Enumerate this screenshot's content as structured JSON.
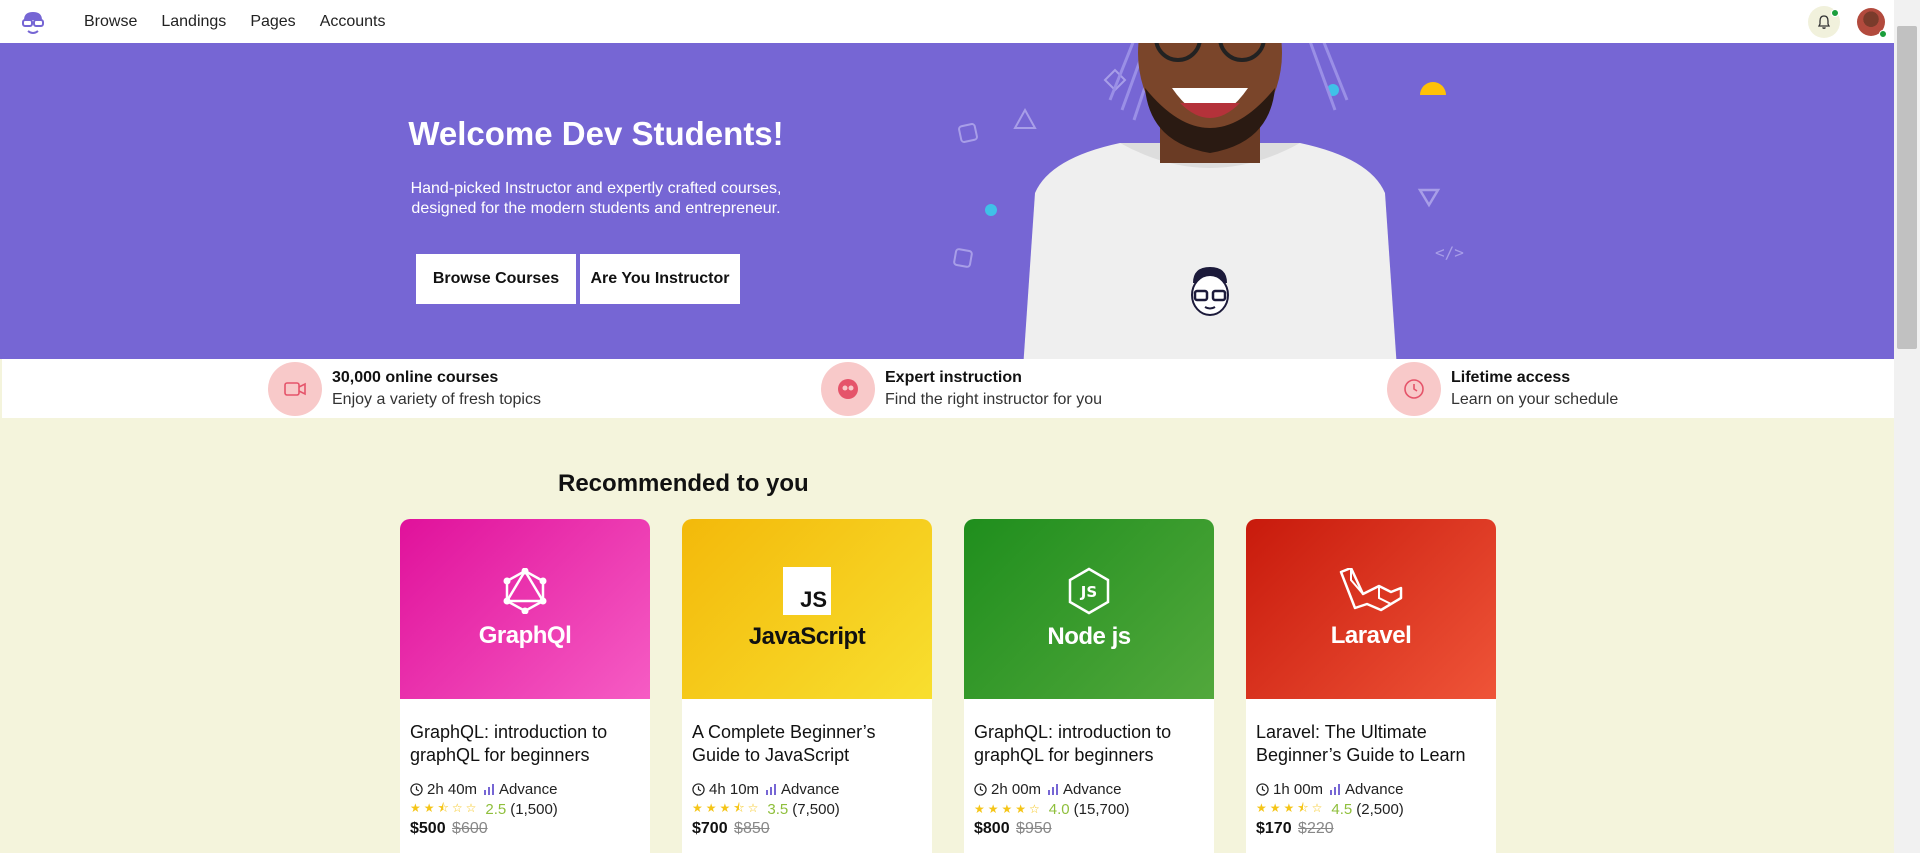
{
  "nav": {
    "links": [
      "Browse",
      "Landings",
      "Pages",
      "Accounts"
    ]
  },
  "hero": {
    "title": "Welcome Dev Students!",
    "subtitle": "Hand-picked Instructor and expertly crafted courses, designed for the modern students and entrepreneur.",
    "browse_button": "Browse Courses",
    "instructor_button": "Are You Instructor",
    "background_color": "#7666d4"
  },
  "features": [
    {
      "icon": "video-icon",
      "title": "30,000 online courses",
      "subtitle": "Enjoy a variety of fresh topics"
    },
    {
      "icon": "users-icon",
      "title": "Expert instruction",
      "subtitle": "Find the right instructor for you"
    },
    {
      "icon": "clock-icon",
      "title": "Lifetime access",
      "subtitle": "Learn on your schedule"
    }
  ],
  "recommended": {
    "heading": "Recommended to you",
    "courses": [
      {
        "logo_text": "GraphQl",
        "title": "GraphQL: introduction to graphQL for beginners",
        "duration": "2h 40m",
        "level": "Advance",
        "rating": "2.5",
        "reviews": "(1,500)",
        "price": "$500",
        "old_price": "$600",
        "stars": "★★⯪☆☆",
        "gradient": [
          "#e0119b",
          "#f65cc4"
        ]
      },
      {
        "logo_text": "JavaScript",
        "title": "A Complete Beginner’s Guide to JavaScript",
        "duration": "4h 10m",
        "level": "Advance",
        "rating": "3.5",
        "reviews": "(7,500)",
        "price": "$700",
        "old_price": "$850",
        "stars": "★★★⯪☆",
        "gradient": [
          "#f3b90a",
          "#f8df2f"
        ]
      },
      {
        "logo_text": "Node js",
        "title": "GraphQL: introduction to graphQL for beginners",
        "duration": "2h 00m",
        "level": "Advance",
        "rating": "4.0",
        "reviews": "(15,700)",
        "price": "$800",
        "old_price": "$950",
        "stars": "★★★★☆",
        "gradient": [
          "#1f8e1d",
          "#52a83c"
        ]
      },
      {
        "logo_text": "Laravel",
        "title": "Laravel: The Ultimate Beginner’s Guide to Learn",
        "duration": "1h 00m",
        "level": "Advance",
        "rating": "4.5",
        "reviews": "(2,500)",
        "price": "$170",
        "old_price": "$220",
        "stars": "★★★⯪☆",
        "gradient": [
          "#c81a0c",
          "#ef5438"
        ]
      }
    ]
  }
}
